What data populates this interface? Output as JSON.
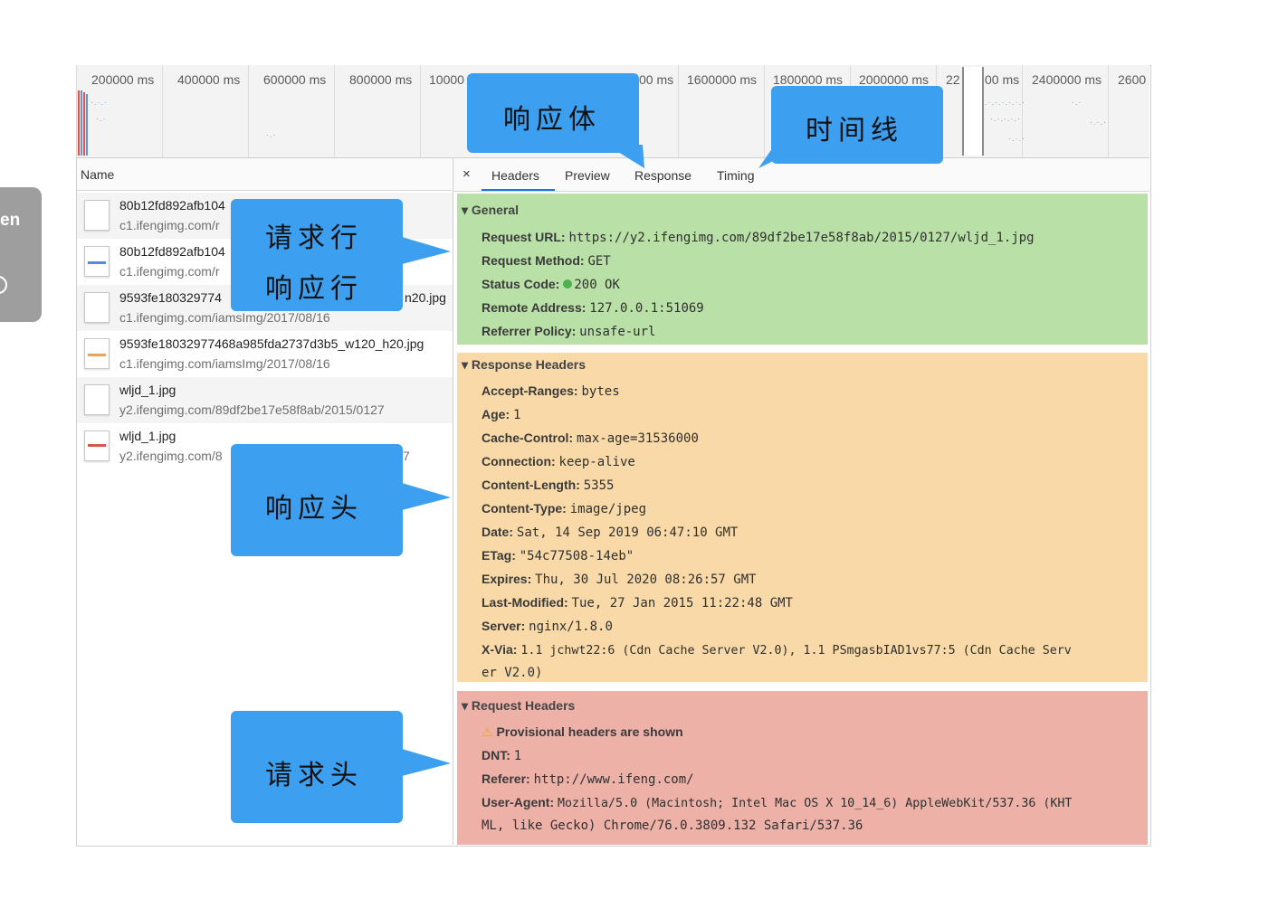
{
  "side_chip": {
    "text": "en"
  },
  "timeline": {
    "ticks": [
      "200000 ms",
      "400000 ms",
      "600000 ms",
      "800000 ms",
      "10000",
      "00 ms",
      "1600000 ms",
      "1800000 ms",
      "2000000 ms",
      "22",
      "00 ms",
      "2400000 ms",
      "2600"
    ]
  },
  "list": {
    "header": "Name",
    "rows": [
      {
        "name": "80b12fd892afb104",
        "domain": "c1.ifengimg.com/r",
        "icon": "file-icon"
      },
      {
        "name": "80b12fd892afb104",
        "domain": "c1.ifengimg.com/r",
        "icon": "image-icon"
      },
      {
        "name": "9593fe180329774",
        "name_tail": "n20.jpg",
        "domain": "c1.ifengimg.com/iamsImg/2017/08/16",
        "icon": "file-icon"
      },
      {
        "name": "9593fe18032977468a985fda2737d3b5_w120_h20.jpg",
        "domain": "c1.ifengimg.com/iamsImg/2017/08/16",
        "icon": "image-icon"
      },
      {
        "name": "wljd_1.jpg",
        "domain": "y2.ifengimg.com/89df2be17e58f8ab/2015/0127",
        "icon": "file-icon"
      },
      {
        "name": "wljd_1.jpg",
        "domain": "y2.ifengimg.com/8",
        "domain_tail": "7",
        "icon": "image-icon"
      }
    ]
  },
  "tabs": {
    "close": "×",
    "headers": "Headers",
    "preview": "Preview",
    "response": "Response",
    "timing": "Timing"
  },
  "general": {
    "title": "General",
    "items": [
      {
        "k": "Request URL:",
        "v": "https://y2.ifengimg.com/89df2be17e58f8ab/2015/0127/wljd_1.jpg"
      },
      {
        "k": "Request Method:",
        "v": "GET"
      },
      {
        "k": "Status Code:",
        "v": "200 OK"
      },
      {
        "k": "Remote Address:",
        "v": "127.0.0.1:51069"
      },
      {
        "k": "Referrer Policy:",
        "v": "unsafe-url"
      }
    ]
  },
  "response_headers": {
    "title": "Response Headers",
    "items": [
      {
        "k": "Accept-Ranges:",
        "v": "bytes"
      },
      {
        "k": "Age:",
        "v": "1"
      },
      {
        "k": "Cache-Control:",
        "v": "max-age=31536000"
      },
      {
        "k": "Connection:",
        "v": "keep-alive"
      },
      {
        "k": "Content-Length:",
        "v": "5355"
      },
      {
        "k": "Content-Type:",
        "v": "image/jpeg"
      },
      {
        "k": "Date:",
        "v": "Sat, 14 Sep 2019 06:47:10 GMT"
      },
      {
        "k": "ETag:",
        "v": "\"54c77508-14eb\""
      },
      {
        "k": "Expires:",
        "v": "Thu, 30 Jul 2020 08:26:57 GMT"
      },
      {
        "k": "Last-Modified:",
        "v": "Tue, 27 Jan 2015 11:22:48 GMT"
      },
      {
        "k": "Server:",
        "v": "nginx/1.8.0"
      },
      {
        "k": "X-Via:",
        "v": "1.1 jchwt22:6 (Cdn Cache Server V2.0), 1.1 PSmgasbIAD1vs77:5 (Cdn Cache Serv"
      }
    ],
    "wrap": "er V2.0)"
  },
  "request_headers": {
    "title": "Request Headers",
    "warning": "Provisional headers are shown",
    "items": [
      {
        "k": "DNT:",
        "v": "1"
      },
      {
        "k": "Referer:",
        "v": "http://www.ifeng.com/"
      },
      {
        "k": "User-Agent:",
        "v": "Mozilla/5.0 (Macintosh; Intel Mac OS X 10_14_6) AppleWebKit/537.36 (KHT"
      }
    ],
    "wrap": "ML, like Gecko) Chrome/76.0.3809.132 Safari/537.36"
  },
  "callouts": {
    "response_body": "响应体",
    "timeline": "时间线",
    "request_line": "请求行",
    "response_line": "响应行",
    "response_header": "响应头",
    "request_header": "请求头"
  },
  "colors": {
    "general": "#b9e0a6",
    "response": "#f8d9a7",
    "request": "#edb1a8",
    "callout": "#3c9ff0",
    "tab_active": "#1a73e8"
  }
}
